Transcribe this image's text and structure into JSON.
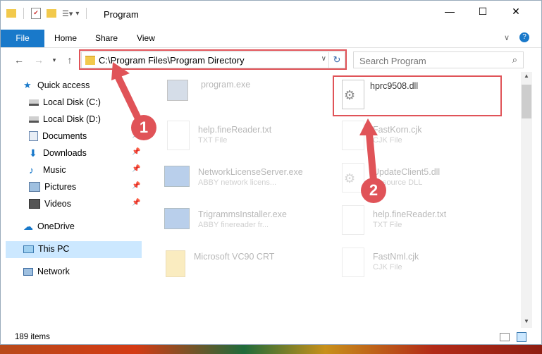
{
  "window": {
    "title": "Program"
  },
  "ribbon": {
    "tabs": [
      "File",
      "Home",
      "Share",
      "View"
    ]
  },
  "address": {
    "path": "C:\\Program Files\\Program Directory"
  },
  "search": {
    "placeholder": "Search Program"
  },
  "sidebar": {
    "items": [
      {
        "label": "Quick access",
        "icon": "star-icon"
      },
      {
        "label": "Local Disk (C:)",
        "icon": "drive-icon"
      },
      {
        "label": "Local Disk (D:)",
        "icon": "drive-icon"
      },
      {
        "label": "Documents",
        "icon": "documents-icon"
      },
      {
        "label": "Downloads",
        "icon": "download-icon"
      },
      {
        "label": "Music",
        "icon": "music-icon"
      },
      {
        "label": "Pictures",
        "icon": "pictures-icon"
      },
      {
        "label": "Videos",
        "icon": "videos-icon"
      },
      {
        "label": "OneDrive",
        "icon": "cloud-icon"
      },
      {
        "label": "This PC",
        "icon": "computer-icon"
      },
      {
        "label": "Network",
        "icon": "network-icon"
      }
    ]
  },
  "files": [
    {
      "name": "program.exe",
      "type": ""
    },
    {
      "name": "hprc9508.dll",
      "type": ""
    },
    {
      "name": "help.fineReader.txt",
      "type": "TXT File"
    },
    {
      "name": "FastKorn.cjk",
      "type": "CJK File"
    },
    {
      "name": "NetworkLicenseServer.exe",
      "type": "ABBY network licens..."
    },
    {
      "name": "UpdateClient5.dll",
      "type": "Resource DLL"
    },
    {
      "name": "TrigrammsInstaller.exe",
      "type": "ABBY finereader fr..."
    },
    {
      "name": "help.fineReader.txt",
      "type": "TXT File"
    },
    {
      "name": "Microsoft VC90 CRT",
      "type": ""
    },
    {
      "name": "FastNml.cjk",
      "type": "CJK File"
    }
  ],
  "status": {
    "count": "189 items"
  },
  "callouts": {
    "one": "1",
    "two": "2"
  },
  "colors": {
    "accent": "#1979ca",
    "highlight": "#e05358",
    "selection": "#cce8ff"
  }
}
